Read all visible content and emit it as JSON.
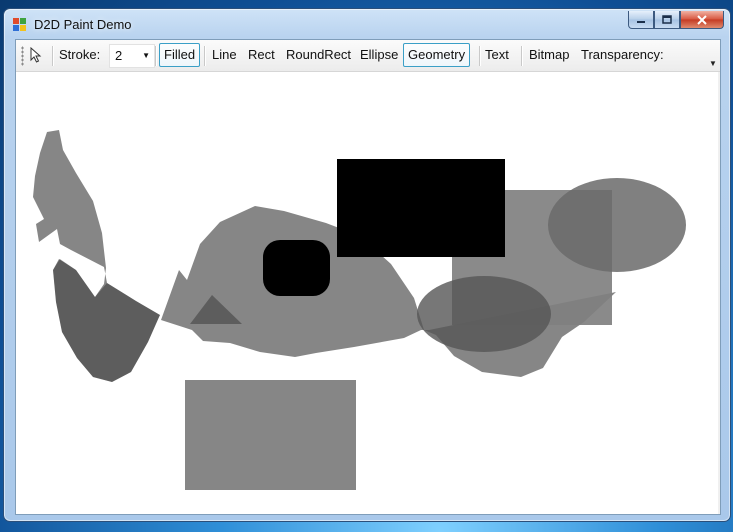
{
  "window": {
    "title": "D2D Paint Demo"
  },
  "caption": {
    "minimize_icon": "minimize-icon",
    "maximize_icon": "maximize-icon",
    "close_icon": "close-icon"
  },
  "toolbar": {
    "pointer_icon": "pointer-arrow-icon",
    "stroke_label": "Stroke:",
    "stroke_value": "2",
    "items": [
      "Filled",
      "Line",
      "Rect",
      "RoundRect",
      "Ellipse",
      "Geometry",
      "Text",
      "Bitmap",
      "Transparency:"
    ],
    "highlighted": [
      "Filled",
      "Geometry"
    ]
  },
  "colors": {
    "shape_gray": "#808080",
    "shape_dark": "#000000",
    "accent_border": "#3a9fc7"
  }
}
